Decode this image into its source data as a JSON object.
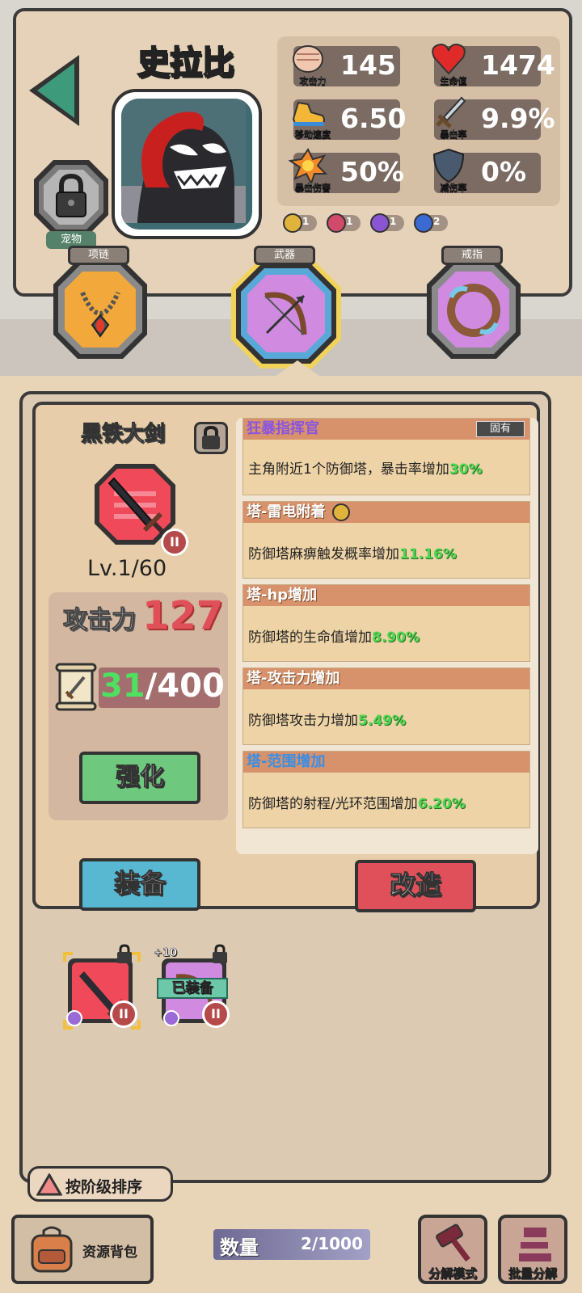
{
  "hero": {
    "name": "史拉比",
    "pet_label": "宠物",
    "stats": [
      {
        "label": "攻击力",
        "value": "145",
        "icon": "fist-icon"
      },
      {
        "label": "生命值",
        "value": "1474",
        "icon": "heart-icon"
      },
      {
        "label": "移动速度",
        "value": "6.50",
        "icon": "shoe-icon"
      },
      {
        "label": "暴击率",
        "value": "9.9%",
        "icon": "sword-icon"
      },
      {
        "label": "暴击伤害",
        "value": "50%",
        "icon": "explosion-icon"
      },
      {
        "label": "减伤率",
        "value": "0%",
        "icon": "shield-icon"
      }
    ],
    "element_badges": [
      {
        "icon": "lightning-icon",
        "count": "1",
        "color": "#e0b43a"
      },
      {
        "icon": "fire-icon",
        "count": "1",
        "color": "#d24a6a"
      },
      {
        "icon": "swirl-icon",
        "count": "1",
        "color": "#8a55d2"
      },
      {
        "icon": "water-icon",
        "count": "2",
        "color": "#3a6ad2"
      }
    ]
  },
  "slots": {
    "necklace": "项链",
    "weapon": "武器",
    "ring": "戒指"
  },
  "weapon": {
    "name": "黑铁大剑",
    "tier": "II",
    "level": "Lv.1/60",
    "atk_label": "攻击力",
    "atk_value": "127",
    "shards_current": "31",
    "shards_total": "/400",
    "upgrade_label": "强化",
    "equip_label": "装备",
    "reforge_label": "改造"
  },
  "skills": [
    {
      "name": "狂暴指挥官",
      "tag": "固有",
      "desc": "主角附近1个防御塔，暴击率增加",
      "value": "30%",
      "name_color": "#8a55e0"
    },
    {
      "name": "塔-雷电附着",
      "tag": "",
      "desc": "防御塔麻痹触发概率增加",
      "value": "11.16%",
      "name_color": "#ffffff"
    },
    {
      "name": "塔-hp增加",
      "tag": "",
      "desc": "防御塔的生命值增加",
      "value": "8.90%",
      "name_color": "#ffffff"
    },
    {
      "name": "塔-攻击力增加",
      "tag": "",
      "desc": "防御塔攻击力增加",
      "value": "5.49%",
      "name_color": "#ffffff"
    },
    {
      "name": "塔-范围增加",
      "tag": "",
      "desc": "防御塔的射程/光环范围增加",
      "value": "6.20%",
      "name_color": "#3a8ee6"
    }
  ],
  "inventory": {
    "items": [
      {
        "name": "黑铁大剑",
        "tier": "II",
        "plus": "",
        "equipped_label": ""
      },
      {
        "name": "弓",
        "tier": "II",
        "plus": "+10",
        "equipped_label": "已装备"
      }
    ],
    "sort_label": "按阶级排序"
  },
  "bottom": {
    "backpack_label": "资源背包",
    "count_label": "数量",
    "count_value": "2/1000",
    "decompose_mode_label": "分解模式",
    "batch_decompose_label": "批量分解"
  }
}
